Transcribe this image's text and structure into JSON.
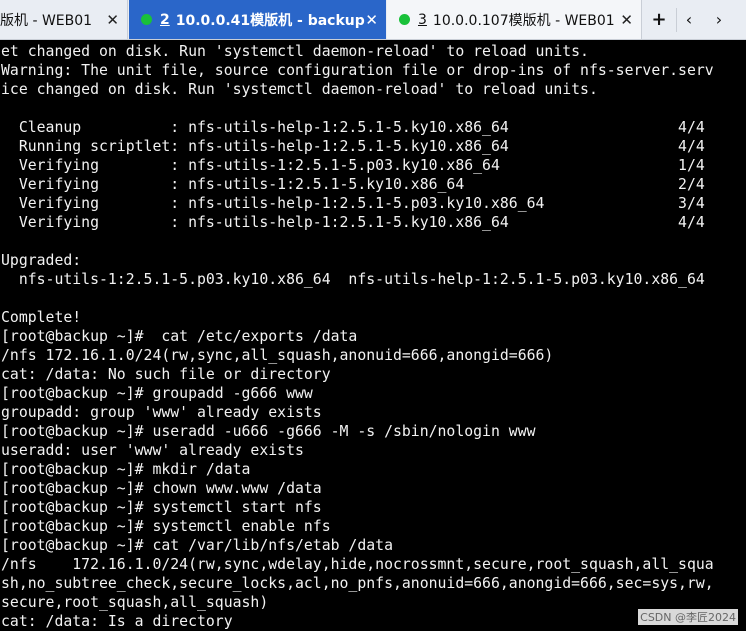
{
  "tabs": [
    {
      "number": "",
      "title": "版机 - WEB01",
      "active": false
    },
    {
      "number": "2",
      "title": "10.0.0.41模版机 - backup",
      "active": true
    },
    {
      "number": "3",
      "title": "10.0.0.107模版机 - WEB01",
      "active": false
    }
  ],
  "tab_controls": {
    "close_glyph": "✕",
    "add_glyph": "+",
    "prev_glyph": "‹",
    "next_glyph": "›"
  },
  "status_color": "#19c13a",
  "terminal_lines": [
    "et changed on disk. Run 'systemctl daemon-reload' to reload units.",
    "Warning: The unit file, source configuration file or drop-ins of nfs-server.serv",
    "ice changed on disk. Run 'systemctl daemon-reload' to reload units.",
    "",
    "  Cleanup          : nfs-utils-help-1:2.5.1-5.ky10.x86_64                   4/4",
    "  Running scriptlet: nfs-utils-help-1:2.5.1-5.ky10.x86_64                   4/4",
    "  Verifying        : nfs-utils-1:2.5.1-5.p03.ky10.x86_64                    1/4",
    "  Verifying        : nfs-utils-1:2.5.1-5.ky10.x86_64                        2/4",
    "  Verifying        : nfs-utils-help-1:2.5.1-5.p03.ky10.x86_64               3/4",
    "  Verifying        : nfs-utils-help-1:2.5.1-5.ky10.x86_64                   4/4",
    "",
    "Upgraded:",
    "  nfs-utils-1:2.5.1-5.p03.ky10.x86_64  nfs-utils-help-1:2.5.1-5.p03.ky10.x86_64",
    "",
    "Complete!",
    "[root@backup ~]#  cat /etc/exports /data",
    "/nfs 172.16.1.0/24(rw,sync,all_squash,anonuid=666,anongid=666)",
    "cat: /data: No such file or directory",
    "[root@backup ~]# groupadd -g666 www",
    "groupadd: group 'www' already exists",
    "[root@backup ~]# useradd -u666 -g666 -M -s /sbin/nologin www",
    "useradd: user 'www' already exists",
    "[root@backup ~]# mkdir /data",
    "[root@backup ~]# chown www.www /data",
    "[root@backup ~]# systemctl start nfs",
    "[root@backup ~]# systemctl enable nfs",
    "[root@backup ~]# cat /var/lib/nfs/etab /data",
    "/nfs    172.16.1.0/24(rw,sync,wdelay,hide,nocrossmnt,secure,root_squash,all_squa",
    "sh,no_subtree_check,secure_locks,acl,no_pnfs,anonuid=666,anongid=666,sec=sys,rw,",
    "secure,root_squash,all_squash)",
    "cat: /data: Is a directory"
  ],
  "watermark": "CSDN @李匠2024"
}
